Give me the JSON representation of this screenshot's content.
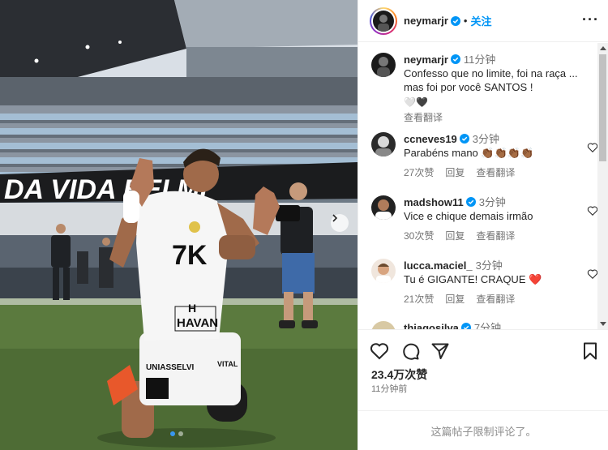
{
  "header": {
    "username": "neymarjr",
    "follow_label": "关注",
    "more_icon": "more-horizontal-icon"
  },
  "caption": {
    "username": "neymarjr",
    "time": "11分钟",
    "text": "Confesso que no limite, foi na raça ... mas foi por você SANTOS !",
    "emoji": "🤍🖤",
    "translate_label": "查看翻译"
  },
  "comments": [
    {
      "username": "ccneves19",
      "time": "3分钟",
      "text": "Parabéns mano 👏🏾👏🏾👏🏾👏🏾",
      "likes": "27次赞",
      "reply": "回复",
      "translate": "查看翻译"
    },
    {
      "username": "madshow11",
      "time": "3分钟",
      "text": "Vice e chique demais irmão",
      "likes": "30次赞",
      "reply": "回复",
      "translate": "查看翻译"
    },
    {
      "username": "lucca.maciel_",
      "time": "3分钟",
      "text": "Tu é GIGANTE! CRAQUE ❤️",
      "likes": "21次赞",
      "reply": "回复",
      "translate": "查看翻译"
    },
    {
      "username": "thiagosilva",
      "time": "7分钟",
      "text": "",
      "likes": "",
      "reply": "",
      "translate": ""
    }
  ],
  "stats": {
    "likes": "23.4万次赞",
    "time_ago": "11分钟前"
  },
  "footer": {
    "comments_limited": "这篇帖子限制评论了。"
  },
  "photo": {
    "banner_text": "DA VIDA BEI MI",
    "shirt_number": "7K",
    "sponsor": "HAVAN",
    "sponsor_top": "H",
    "sleeve_text": "UNIASSELVI",
    "shorts_text": "VITAL"
  },
  "colors": {
    "accent": "#0095f6",
    "verified": "#0095f6",
    "heart_red": "#ed4956",
    "carousel_active": "#3897f0"
  }
}
